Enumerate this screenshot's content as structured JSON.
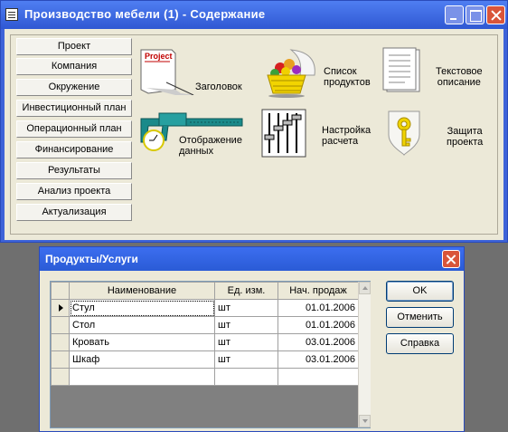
{
  "window": {
    "title": "Производство мебели (1) - Содержание"
  },
  "sidebar": {
    "items": [
      "Проект",
      "Компания",
      "Окружение",
      "Инвестиционный план",
      "Операционный план",
      "Финансирование",
      "Результаты",
      "Анализ проекта",
      "Актуализация"
    ]
  },
  "tiles": [
    {
      "label": "Заголовок",
      "icon": "project-document-icon",
      "icon_text": "Project"
    },
    {
      "label": "Список\nпродуктов",
      "icon": "fruit-basket-icon"
    },
    {
      "label": "Текстовое\nописание",
      "icon": "text-document-icon"
    },
    {
      "label": "Отображение\nданных",
      "icon": "caliper-icon"
    },
    {
      "label": "Настройка\nрасчета",
      "icon": "sliders-icon"
    },
    {
      "label": "Защита\nпроекта",
      "icon": "key-shield-icon"
    }
  ],
  "dialog": {
    "title": "Продукты/Услуги",
    "columns": [
      "Наименование",
      "Ед. изм.",
      "Нач. продаж"
    ],
    "rows": [
      [
        "Стул",
        "шт",
        "01.01.2006"
      ],
      [
        "Стол",
        "шт",
        "01.01.2006"
      ],
      [
        "Кровать",
        "шт",
        "03.01.2006"
      ],
      [
        "Шкаф",
        "шт",
        "03.01.2006"
      ]
    ],
    "buttons": {
      "ok": "OK",
      "cancel": "Отменить",
      "help": "Справка"
    }
  },
  "colors": {
    "titlebar": "#3e63d8",
    "close_button": "#d9553a",
    "face": "#ece9d8"
  }
}
